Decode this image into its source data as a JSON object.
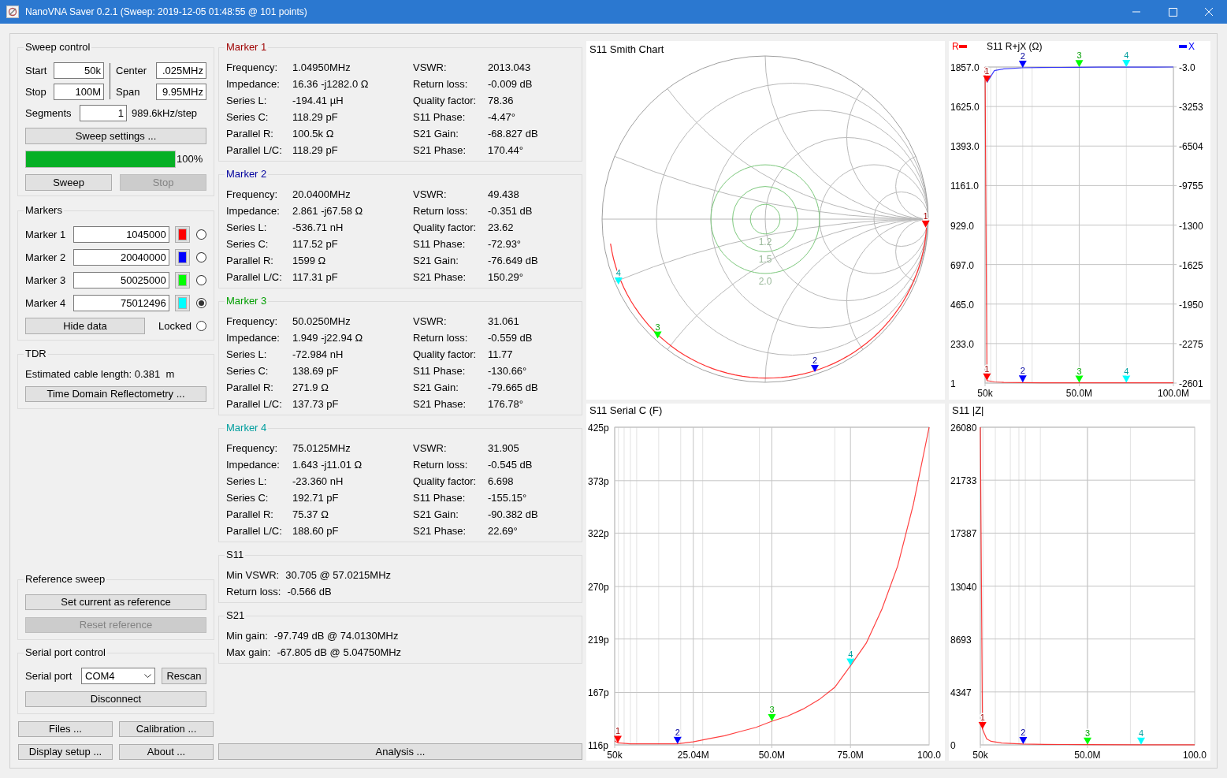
{
  "window": {
    "title": "NanoVNA Saver 0.2.1 (Sweep: 2019-12-05 01:48:55 @ 101 points)"
  },
  "sweep_control": {
    "title": "Sweep control",
    "fields": [
      {
        "label": "Start",
        "value": "50k"
      },
      {
        "label": "Center",
        "value": ".025MHz"
      },
      {
        "label": "Stop",
        "value": "100M"
      },
      {
        "label": "Span",
        "value": "9.95MHz"
      }
    ],
    "segments": {
      "label": "Segments",
      "value": "1"
    },
    "step": "989.6kHz/step",
    "settings_button": "Sweep settings ...",
    "progress": {
      "level": 1,
      "reading": "100%"
    },
    "buttons": [
      {
        "label": "Sweep",
        "disabled": false
      },
      {
        "label": "Stop",
        "disabled": true
      }
    ]
  },
  "markers": {
    "title": "Markers",
    "items": [
      {
        "label": "Marker 1",
        "value": "1045000",
        "color": "#ff0000",
        "selected": false
      },
      {
        "label": "Marker 2",
        "value": "20040000",
        "color": "#0000ff",
        "selected": false
      },
      {
        "label": "Marker 3",
        "value": "50025000",
        "color": "#00ff00",
        "selected": false
      },
      {
        "label": "Marker 4",
        "value": "75012496",
        "color": "#00ffff",
        "selected": true
      }
    ],
    "hide_button": "Hide data",
    "locked": {
      "label": "Locked",
      "checked": false
    }
  },
  "tdr": {
    "title": "TDR",
    "cable_length": "Estimated cable length: 0.381  m",
    "button": "Time Domain Reflectometry ..."
  },
  "reference_sweep": {
    "title": "Reference sweep",
    "buttons": [
      {
        "label": "Set current as reference",
        "disabled": false
      },
      {
        "label": "Reset reference",
        "disabled": true
      }
    ]
  },
  "serial_port": {
    "title": "Serial port control",
    "label": "Serial port",
    "port": "COM4",
    "rescan": "Rescan",
    "disconnect": "Disconnect"
  },
  "bottom_buttons": [
    "Files ...",
    "Calibration ...",
    "Display setup ...",
    "About ..."
  ],
  "marker_data": [
    {
      "title": "Marker 1",
      "left": [
        {
          "label": "Frequency:",
          "value": "1.04950MHz"
        },
        {
          "label": "Impedance:",
          "value": "16.36 -j1282.0 Ω"
        },
        {
          "label": "Series L:",
          "value": "-194.41 µH"
        },
        {
          "label": "Series C:",
          "value": "118.29 pF"
        },
        {
          "label": "Parallel R:",
          "value": "100.5k Ω"
        },
        {
          "label": "Parallel L/C:",
          "value": "118.29 pF"
        }
      ],
      "right": [
        {
          "label": "VSWR:",
          "value": "2013.043"
        },
        {
          "label": "Return loss:",
          "value": "-0.009 dB"
        },
        {
          "label": "Quality factor:",
          "value": "78.36"
        },
        {
          "label": "S11 Phase:",
          "value": "-4.47°"
        },
        {
          "label": "S21 Gain:",
          "value": "-68.827 dB"
        },
        {
          "label": "S21 Phase:",
          "value": "170.44°"
        }
      ]
    },
    {
      "title": "Marker 2",
      "left": [
        {
          "label": "Frequency:",
          "value": "20.0400MHz"
        },
        {
          "label": "Impedance:",
          "value": "2.861 -j67.58 Ω"
        },
        {
          "label": "Series L:",
          "value": "-536.71 nH"
        },
        {
          "label": "Series C:",
          "value": "117.52 pF"
        },
        {
          "label": "Parallel R:",
          "value": "1599 Ω"
        },
        {
          "label": "Parallel L/C:",
          "value": "117.31 pF"
        }
      ],
      "right": [
        {
          "label": "VSWR:",
          "value": "49.438"
        },
        {
          "label": "Return loss:",
          "value": "-0.351 dB"
        },
        {
          "label": "Quality factor:",
          "value": "23.62"
        },
        {
          "label": "S11 Phase:",
          "value": "-72.93°"
        },
        {
          "label": "S21 Gain:",
          "value": "-76.649 dB"
        },
        {
          "label": "S21 Phase:",
          "value": "150.29°"
        }
      ]
    },
    {
      "title": "Marker 3",
      "left": [
        {
          "label": "Frequency:",
          "value": "50.0250MHz"
        },
        {
          "label": "Impedance:",
          "value": "1.949 -j22.94 Ω"
        },
        {
          "label": "Series L:",
          "value": "-72.984 nH"
        },
        {
          "label": "Series C:",
          "value": "138.69 pF"
        },
        {
          "label": "Parallel R:",
          "value": "271.9 Ω"
        },
        {
          "label": "Parallel L/C:",
          "value": "137.73 pF"
        }
      ],
      "right": [
        {
          "label": "VSWR:",
          "value": "31.061"
        },
        {
          "label": "Return loss:",
          "value": "-0.559 dB"
        },
        {
          "label": "Quality factor:",
          "value": "11.77"
        },
        {
          "label": "S11 Phase:",
          "value": "-130.66°"
        },
        {
          "label": "S21 Gain:",
          "value": "-79.665 dB"
        },
        {
          "label": "S21 Phase:",
          "value": "176.78°"
        }
      ]
    },
    {
      "title": "Marker 4",
      "left": [
        {
          "label": "Frequency:",
          "value": "75.0125MHz"
        },
        {
          "label": "Impedance:",
          "value": "1.643 -j11.01 Ω"
        },
        {
          "label": "Series L:",
          "value": "-23.360 nH"
        },
        {
          "label": "Series C:",
          "value": "192.71 pF"
        },
        {
          "label": "Parallel R:",
          "value": "75.37 Ω"
        },
        {
          "label": "Parallel L/C:",
          "value": "188.60 pF"
        }
      ],
      "right": [
        {
          "label": "VSWR:",
          "value": "31.905"
        },
        {
          "label": "Return loss:",
          "value": "-0.545 dB"
        },
        {
          "label": "Quality factor:",
          "value": "6.698"
        },
        {
          "label": "S11 Phase:",
          "value": "-155.15°"
        },
        {
          "label": "S21 Gain:",
          "value": "-90.382 dB"
        },
        {
          "label": "S21 Phase:",
          "value": "22.69°"
        }
      ]
    }
  ],
  "s11_summary": {
    "title": "S11",
    "rows": [
      {
        "label": "Min VSWR:",
        "value": "30.705 @ 57.0215MHz"
      },
      {
        "label": "Return loss:",
        "value": "-0.566 dB"
      }
    ]
  },
  "s21_summary": {
    "title": "S21",
    "rows": [
      {
        "label": "Min gain:",
        "value": "-97.749 dB @ 74.0130MHz"
      },
      {
        "label": "Max gain:",
        "value": "-67.805 dB @ 5.04750MHz"
      }
    ]
  },
  "analysis_button": "Analysis ...",
  "smith_chart": {
    "title": "S11 Smith Chart",
    "vswr_labels": [
      "1.2",
      "1.5",
      "2.0"
    ],
    "markers": [
      {
        "label": "1",
        "color": "#ff0000"
      },
      {
        "label": "2",
        "color": "#0000ff"
      },
      {
        "label": "3",
        "color": "#00ff00"
      },
      {
        "label": "4",
        "color": "#00ffff"
      }
    ]
  },
  "rjx_chart": {
    "chart_data": {
      "type": "line",
      "title": "S11  R+jX (Ω)",
      "x": [
        50000,
        1045000,
        5000000,
        10000000,
        20000000,
        30000000,
        40000000,
        50000000,
        60000000,
        75000000,
        90000000,
        100000000
      ],
      "series": [
        {
          "name": "R",
          "color": "#ff0000",
          "values": [
            1857,
            16,
            8,
            5,
            4,
            3,
            3,
            3,
            3,
            3,
            3,
            3
          ]
        },
        {
          "name": "X",
          "color": "#0000ff",
          "axis": "y2",
          "values": [
            null,
            -1282,
            -300,
            -150,
            -68,
            -45,
            -33,
            -23,
            -17,
            -11,
            -7,
            -5
          ]
        }
      ],
      "xlim": [
        50000,
        100000000
      ],
      "ylim": [
        1,
        1857
      ],
      "y2lim": [
        -26010,
        -3
      ],
      "grid": true,
      "y2ticks": [
        {
          "value": -3,
          "label": "-3.0"
        },
        {
          "value": -3253,
          "label": "-3253"
        },
        {
          "value": -6504,
          "label": "-6504"
        },
        {
          "value": -9755,
          "label": "-9755"
        }
      ],
      "xticks": [
        {
          "value": 50000,
          "label": "50k"
        },
        {
          "value": 50000000,
          "label": "50.0M"
        },
        {
          "value": 100000000,
          "label": "100.0M"
        }
      ],
      "yticks": [
        {
          "value": 1,
          "label": "1"
        },
        {
          "value": 233,
          "label": "233.0"
        },
        {
          "value": 465,
          "label": "465.0"
        },
        {
          "value": 697,
          "label": "697.0"
        },
        {
          "value": 929,
          "label": "929.0"
        },
        {
          "value": 1161,
          "label": "1161.0"
        },
        {
          "value": 1393,
          "label": "1393.0"
        },
        {
          "value": 1625,
          "label": "1625.0"
        },
        {
          "value": 1857,
          "label": "1857.0"
        }
      ]
    },
    "right_axis_cut_labels": [
      "-1300",
      "-1625",
      "-1950",
      "-2275",
      "-2601"
    ],
    "x_markers": [
      {
        "label": "1",
        "color": "#ff0000"
      },
      {
        "label": "2",
        "color": "#0000ff"
      },
      {
        "label": "3",
        "color": "#00ff00"
      },
      {
        "label": "4",
        "color": "#00ffff"
      }
    ],
    "r_markers": [
      {
        "label": "1",
        "color": "#ff0000"
      },
      {
        "label": "2",
        "color": "#0000ff"
      },
      {
        "label": "3",
        "color": "#00ff00"
      },
      {
        "label": "4",
        "color": "#00ffff"
      }
    ]
  },
  "serial_c_chart": {
    "chart_data": {
      "type": "line",
      "title": "S11  Serial C (F)",
      "x": [
        50000,
        1000000,
        5000000,
        10000000,
        15000000,
        20000000,
        25000000,
        30000000,
        35000000,
        40000000,
        45000000,
        50000000,
        55000000,
        60000000,
        65000000,
        70000000,
        75000000,
        80000000,
        85000000,
        90000000,
        95000000,
        100000000
      ],
      "series": [
        {
          "color": "#ff0000",
          "values": [
            120,
            118,
            117,
            117,
            117,
            117,
            119,
            122,
            125,
            129,
            133,
            139,
            144,
            151,
            160,
            172,
            193,
            215,
            248,
            290,
            350,
            425
          ]
        }
      ],
      "xlim": [
        50000,
        100000000
      ],
      "ylim": [
        116,
        425
      ],
      "grid": true,
      "xticks": [
        {
          "value": 50000,
          "label": "50k"
        },
        {
          "value": 25040000,
          "label": "25.04M"
        },
        {
          "value": 50000000,
          "label": "50.0M"
        },
        {
          "value": 75000000,
          "label": "75.0M"
        }
      ],
      "yticks": [
        {
          "value": 116,
          "label": "116p"
        },
        {
          "value": 167,
          "label": "167p"
        },
        {
          "value": 219,
          "label": "219p"
        },
        {
          "value": 270,
          "label": "270p"
        },
        {
          "value": 322,
          "label": "322p"
        },
        {
          "value": 373,
          "label": "373p"
        },
        {
          "value": 425,
          "label": "425p"
        }
      ]
    },
    "x_axis_end_label": "100.0",
    "markers": [
      {
        "label": "1",
        "color": "#ff0000"
      },
      {
        "label": "2",
        "color": "#0000ff"
      },
      {
        "label": "3",
        "color": "#00ff00"
      },
      {
        "label": "4",
        "color": "#00ffff"
      }
    ]
  },
  "impedance_chart": {
    "chart_data": {
      "type": "line",
      "title": "S11  |Z|",
      "x": [
        50000,
        1045000,
        3000000,
        5000000,
        10000000,
        20000000,
        30000000,
        40000000,
        50000000,
        75000000,
        100000000
      ],
      "series": [
        {
          "color": "#ff0000",
          "values": [
            26080,
            1300,
            500,
            300,
            150,
            70,
            45,
            33,
            23,
            11,
            5
          ]
        }
      ],
      "xlim": [
        50000,
        100000000
      ],
      "ylim": [
        0,
        26080
      ],
      "grid": true,
      "xticks": [
        {
          "value": 50000,
          "label": "50k"
        },
        {
          "value": 50000000,
          "label": "50.0M"
        }
      ],
      "yticks": [
        {
          "value": 0,
          "label": "0"
        },
        {
          "value": 4347,
          "label": "4347"
        },
        {
          "value": 8693,
          "label": "8693"
        },
        {
          "value": 13040,
          "label": "13040"
        },
        {
          "value": 17387,
          "label": "17387"
        },
        {
          "value": 21733,
          "label": "21733"
        },
        {
          "value": 26080,
          "label": "26080"
        }
      ]
    },
    "x_axis_end_label": "100.0",
    "markers": [
      {
        "label": "1",
        "color": "#ff0000"
      },
      {
        "label": "2",
        "color": "#0000ff"
      },
      {
        "label": "3",
        "color": "#00ff00"
      },
      {
        "label": "4",
        "color": "#00ffff"
      }
    ]
  }
}
